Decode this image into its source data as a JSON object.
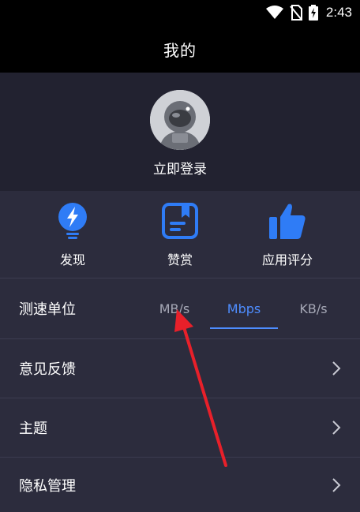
{
  "status_bar": {
    "time": "2:43"
  },
  "app_bar": {
    "title": "我的"
  },
  "profile": {
    "login_label": "立即登录"
  },
  "quick_actions": [
    {
      "label": "发现",
      "icon": "lightning-bulb-icon"
    },
    {
      "label": "赞赏",
      "icon": "bookmark-card-icon"
    },
    {
      "label": "应用评分",
      "icon": "thumbs-up-icon"
    }
  ],
  "speed_unit": {
    "label": "测速单位",
    "options": [
      "MB/s",
      "Mbps",
      "KB/s"
    ],
    "selected": "Mbps"
  },
  "menu": {
    "feedback": "意见反馈",
    "theme": "主题",
    "privacy": "隐私管理"
  },
  "colors": {
    "accent": "#4e8dff",
    "icon_blue": "#2f7cf6",
    "annotation_arrow": "#e8202a"
  }
}
